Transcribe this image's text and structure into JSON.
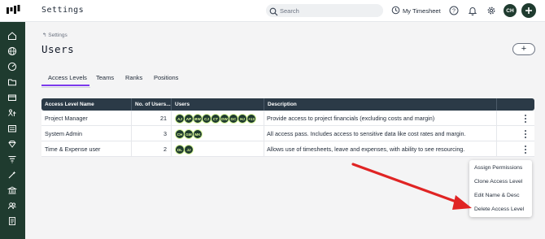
{
  "header": {
    "title": "Settings",
    "search_placeholder": "Search",
    "timesheet_label": "My Timesheet",
    "user_initials": "CH"
  },
  "sidebar": {
    "items": [
      "home-icon",
      "globe-icon",
      "dashboard-icon",
      "folder-icon",
      "card-icon",
      "people-tree-icon",
      "list-icon",
      "gem-icon",
      "filter-icon",
      "wand-icon",
      "bank-icon",
      "contacts-icon",
      "report-icon"
    ]
  },
  "page": {
    "breadcrumb": "↰ Settings",
    "title": "Users",
    "add_label": "+"
  },
  "tabs": [
    {
      "label": "Access Levels",
      "active": true
    },
    {
      "label": "Teams",
      "active": false
    },
    {
      "label": "Ranks",
      "active": false
    },
    {
      "label": "Positions",
      "active": false
    }
  ],
  "table": {
    "columns": [
      "Access Level Name",
      "No. of Users...",
      "Users",
      "Description"
    ],
    "rows": [
      {
        "name": "Project Manager",
        "count": "21",
        "users": [
          "AJ",
          "AP",
          "BW",
          "CJ",
          "CT",
          "DW",
          "GC",
          "HJ",
          "+13"
        ],
        "description": "Provide access to project financials (excluding costs and margin)"
      },
      {
        "name": "System Admin",
        "count": "3",
        "users": [
          "CH",
          "GM",
          "MK"
        ],
        "description": "All access pass. Includes access to sensitive data like cost rates and margin."
      },
      {
        "name": "Time & Expense user",
        "count": "2",
        "users": [
          "DL",
          "JJ"
        ],
        "description": "Allows use of timesheets, leave and expenses, with ability to see resourcing."
      }
    ]
  },
  "context_menu": {
    "items": [
      "Assign Permissions",
      "Clone Access Level",
      "Edit Name & Desc",
      "Delete Access Level"
    ]
  },
  "colors": {
    "brand_dark": "#1f3b2f",
    "table_header": "#2b3a47",
    "tab_accent": "#7c3aed",
    "annotation_arrow": "#e02424"
  }
}
